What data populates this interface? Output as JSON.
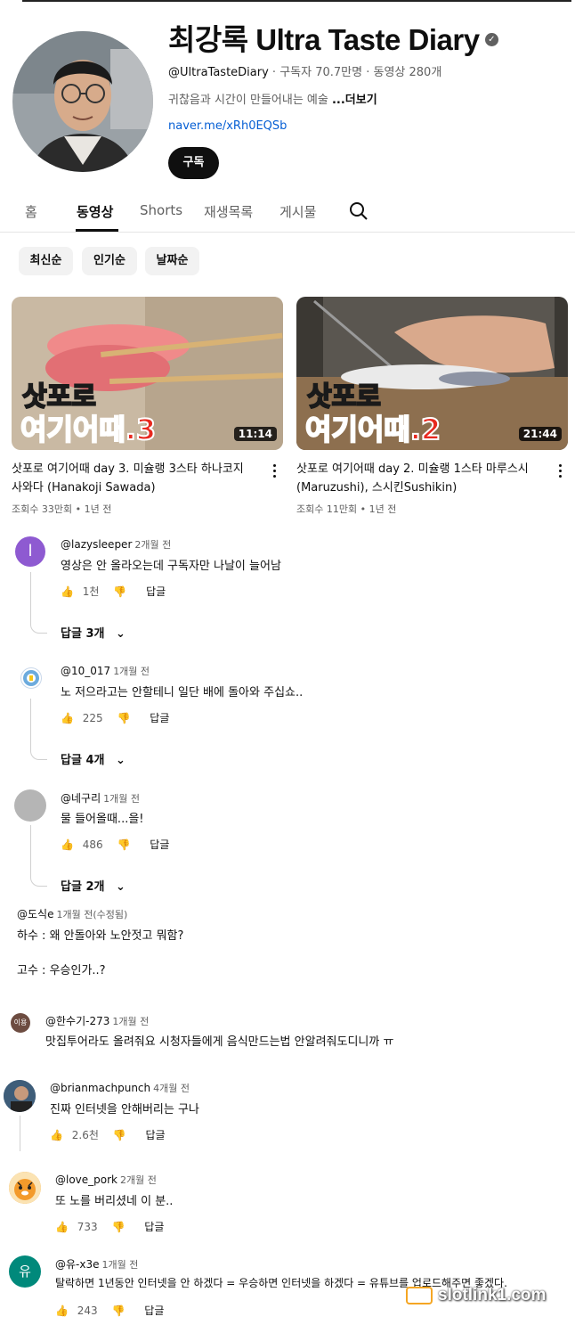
{
  "channel": {
    "name": "최강록 Ultra Taste Diary",
    "handle": "@UltraTasteDiary",
    "subscribers": "구독자 70.7만명",
    "video_count": "동영상 280개",
    "description": "귀찮음과 시간이 만들어내는 예술 ",
    "more_label": "...더보기",
    "link": "naver.me/xRh0EQSb",
    "subscribe_label": "구독"
  },
  "tabs": [
    {
      "label": "홈"
    },
    {
      "label": "동영상"
    },
    {
      "label": "Shorts"
    },
    {
      "label": "재생목록"
    },
    {
      "label": "게시물"
    }
  ],
  "filters": [
    {
      "label": "최신순"
    },
    {
      "label": "인기순"
    },
    {
      "label": "날짜순"
    }
  ],
  "videos": [
    {
      "overlay_line1": "삿포로",
      "overlay_line2": "여기어때.3",
      "duration": "11:14",
      "title": "삿포로 여기어때 day 3. 미슐랭 3스타 하나코지 사와다 (Hanakoji Sawada)",
      "views": "조회수 33만회",
      "age": "1년 전"
    },
    {
      "overlay_line1": "삿포로",
      "overlay_line2": "여기어때.2",
      "duration": "21:44",
      "title": "삿포로 여기어때 day 2. 미슐랭 1스타 마루스시(Maruzushi), 스시킨Sushikin)",
      "views": "조회수 11만회",
      "age": "1년 전"
    }
  ],
  "comments": [
    {
      "avatar_text": "l",
      "avatar_color": "#8e5ad1",
      "user": "@lazysleeper",
      "time": "2개월 전",
      "text": "영상은 안 올라오는데 구독자만 나날이 늘어남",
      "likes": "1천",
      "reply_label": "답글",
      "replies": "답글 3개"
    },
    {
      "avatar_text": "",
      "avatar_color": "#ffffff",
      "user": "@10_017",
      "time": "1개월 전",
      "text": "노 저으라고는 안할테니 일단 배에 돌아와 주십쇼..",
      "likes": "225",
      "reply_label": "답글",
      "replies": "답글 4개"
    },
    {
      "avatar_text": "",
      "avatar_color": "#b5b5b5",
      "user": "@네구리",
      "time": "1개월 전",
      "text": "물 들어올때...을!",
      "likes": "486",
      "reply_label": "답글",
      "replies": "답글 2개"
    },
    {
      "user": "@도식e",
      "time": "1개월 전(수정됨)",
      "text_lines": [
        "하수 : 왜 안돌아와 노안젓고 뭐함?",
        "고수 : 우승인가..?"
      ]
    },
    {
      "avatar_text": "이용",
      "avatar_color": "#6d4c41",
      "user": "@한수기-273",
      "time": "1개월 전",
      "text": "맛집투어라도 올려줘요 시청자들에게 음식만드는법 안알려줘도디니까 ㅠ"
    },
    {
      "avatar_text": "",
      "avatar_color": "#4a6a8a",
      "user": "@brianmachpunch",
      "time": "4개월 전",
      "text": "진짜 인터넷을 안해버리는 구나",
      "likes": "2.6천",
      "reply_label": "답글"
    },
    {
      "avatar_text": "",
      "avatar_color": "#f2a93b",
      "user": "@love_pork",
      "time": "2개월 전",
      "text": "또 노를 버리셨네 이 분..",
      "likes": "733",
      "reply_label": "답글"
    },
    {
      "avatar_text": "유",
      "avatar_color": "#00897b",
      "user": "@유-x3e",
      "time": "1개월 전",
      "text": "탈락하면 1년동안 인터넷을 안 하겠다 = 우승하면 인터넷을 하겠다 = 유튜브를 업로드해주면 좋겠다.",
      "likes": "243",
      "reply_label": "답글"
    }
  ],
  "watermark": "slotlink1.com",
  "colors": {
    "link": "#065fd4",
    "overlay_yellow": "#ffd21a",
    "overlay_red": "#e8281e"
  }
}
